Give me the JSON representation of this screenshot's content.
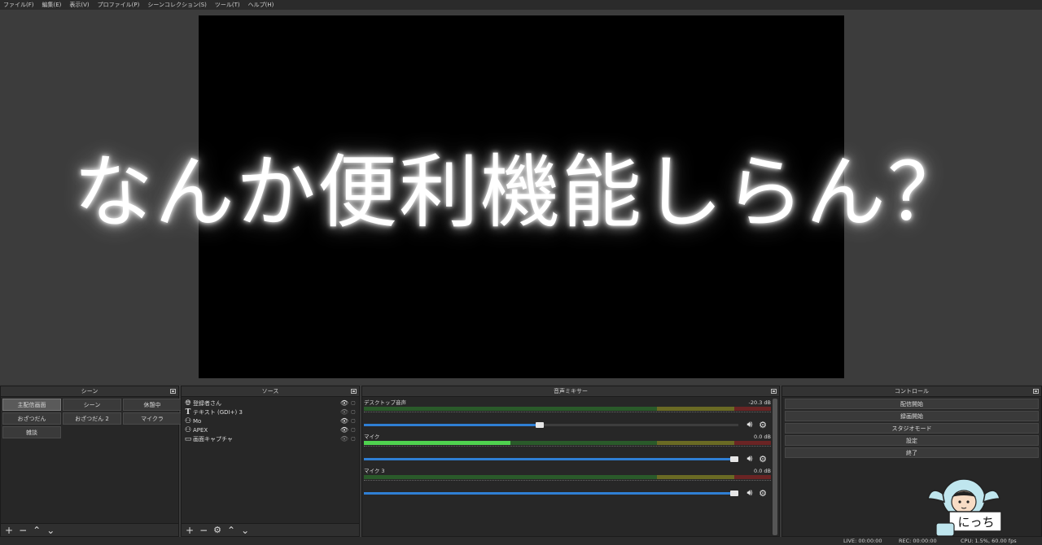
{
  "menu": [
    "ファイル(F)",
    "編集(E)",
    "表示(V)",
    "プロファイル(P)",
    "シーンコレクション(S)",
    "ツール(T)",
    "ヘルプ(H)"
  ],
  "headline": "なんか便利機能しらん？",
  "scenes": {
    "title": "シーン",
    "items": [
      "主配信画面",
      "シーン",
      "休憩中",
      "おざつだん",
      "おざつだん 2",
      "マイクラ",
      "雑談"
    ],
    "active": "主配信画面"
  },
  "sources": {
    "title": "ソース",
    "items": [
      {
        "icon": "globe-icon",
        "name": "登録者さん",
        "visible": true
      },
      {
        "icon": "text-icon",
        "name": "テキスト (GDI+) 3",
        "visible": false
      },
      {
        "icon": "camera-icon",
        "name": "Mo",
        "visible": true
      },
      {
        "icon": "camera-icon",
        "name": "APEX",
        "visible": true
      },
      {
        "icon": "monitor-icon",
        "name": "画面キャプチャ",
        "visible": false
      }
    ]
  },
  "mixer": {
    "title": "音声ミキサー",
    "channels": [
      {
        "name": "デスクトップ音声",
        "db": "-20.3 dB",
        "level": 0.0,
        "volume": 0.48
      },
      {
        "name": "マイク",
        "db": "0.0 dB",
        "level": 0.36,
        "volume": 1.0
      },
      {
        "name": "マイク 3",
        "db": "0.0 dB",
        "level": 0.0,
        "volume": 1.0
      }
    ]
  },
  "controls": {
    "title": "コントロール",
    "buttons": [
      "配信開始",
      "録画開始",
      "スタジオモード",
      "設定",
      "終了"
    ]
  },
  "status": {
    "live": "LIVE: 00:00:00",
    "rec": "REC: 00:00:00",
    "cpu": "CPU: 1.5%, 60.00 fps"
  },
  "mascot_label": "にっち",
  "colors": {
    "meter_green": "#4fd24f",
    "fader_blue": "#2f7fd4",
    "preview_bg": "#000000"
  }
}
